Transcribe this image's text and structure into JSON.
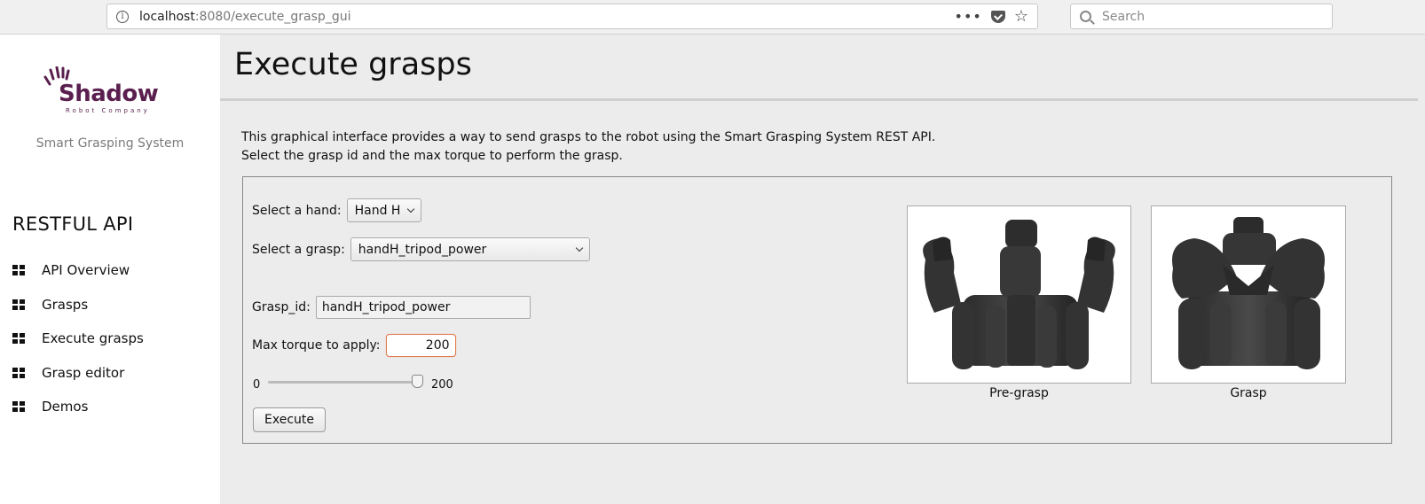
{
  "browser": {
    "url_host": "localhost",
    "url_rest": ":8080/execute_grasp_gui",
    "search_placeholder": "Search"
  },
  "sidebar": {
    "logo_text": "Shadow",
    "logo_subtext": "Robot Company",
    "tagline": "Smart Grasping System",
    "section_title": "RESTFUL API",
    "items": [
      {
        "label": "API Overview"
      },
      {
        "label": "Grasps"
      },
      {
        "label": "Execute grasps"
      },
      {
        "label": "Grasp editor"
      },
      {
        "label": "Demos"
      }
    ]
  },
  "main": {
    "title": "Execute grasps",
    "description_line1": "This graphical interface provides a way to send grasps to the robot using the Smart Grasping System REST API.",
    "description_line2": "Select the grasp id and the max torque to perform the grasp.",
    "form": {
      "hand_label": "Select a hand:",
      "hand_value": "Hand H",
      "grasp_label": "Select a grasp:",
      "grasp_value": "handH_tripod_power",
      "grasp_id_label": "Grasp_id:",
      "grasp_id_value": "handH_tripod_power",
      "torque_label": "Max torque to apply:",
      "torque_value": "200",
      "slider_min": "0",
      "slider_max": "200",
      "slider_fraction": 1.0,
      "execute_label": "Execute"
    },
    "images": {
      "pregrasp_caption": "Pre-grasp",
      "grasp_caption": "Grasp"
    }
  },
  "colors": {
    "brand": "#5a1f4f",
    "torque_border": "#e07a50"
  }
}
